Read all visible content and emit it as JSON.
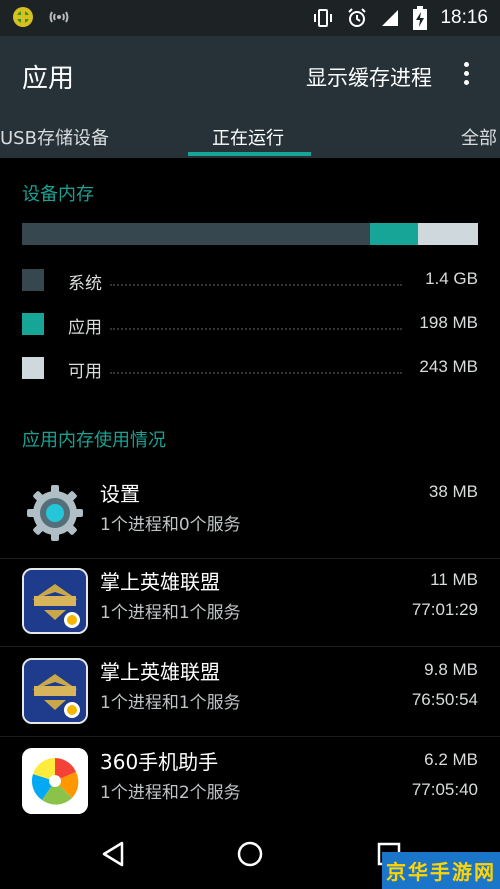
{
  "status_bar": {
    "time": "18:16",
    "left_icons": [
      "game-notification-icon",
      "wifi-signal-icon"
    ],
    "right_icons": [
      "vibrate-icon",
      "alarm-icon",
      "signal-icon",
      "battery-charging-icon"
    ]
  },
  "action_bar": {
    "title": "应用",
    "show_cached_label": "显示缓存进程",
    "overflow_icon": "overflow-menu-icon"
  },
  "tabs": [
    {
      "label": "USB存储设备",
      "selected": false
    },
    {
      "label": "正在运行",
      "selected": true
    },
    {
      "label": "全部",
      "selected": false
    }
  ],
  "device_memory": {
    "header": "设备内存",
    "system_fraction": 0.763,
    "apps_fraction": 0.105,
    "legend": [
      {
        "label": "系统",
        "value": "1.4 GB",
        "color": "#37474f"
      },
      {
        "label": "应用",
        "value": "198 MB",
        "color": "#17a598"
      },
      {
        "label": "可用",
        "value": "243 MB",
        "color": "#cfd8dc"
      }
    ]
  },
  "app_memory": {
    "header": "应用内存使用情况",
    "apps": [
      {
        "name": "设置",
        "procs": "1个进程和0个服务",
        "size": "38 MB",
        "time": "",
        "icon": "settings-gear-icon"
      },
      {
        "name": "掌上英雄联盟",
        "procs": "1个进程和1个服务",
        "size": "11 MB",
        "time": "77:01:29",
        "icon": "lol-app-icon"
      },
      {
        "name": "掌上英雄联盟",
        "procs": "1个进程和1个服务",
        "size": "9.8 MB",
        "time": "76:50:54",
        "icon": "lol-app-icon"
      },
      {
        "name": "360手机助手",
        "procs": "1个进程和2个服务",
        "size": "6.2 MB",
        "time": "77:05:40",
        "icon": "360-assistant-icon"
      }
    ]
  },
  "nav_bar": {
    "buttons": [
      "back-icon",
      "home-icon",
      "recents-icon"
    ]
  },
  "watermark": {
    "text": "京华手游网",
    "colors": {
      "background": "#1b75c9",
      "text": "#ffd400"
    }
  },
  "colors": {
    "accent": "#17a598",
    "action_bar": "#263238",
    "status_bar": "#1d2224",
    "background": "#000000"
  }
}
